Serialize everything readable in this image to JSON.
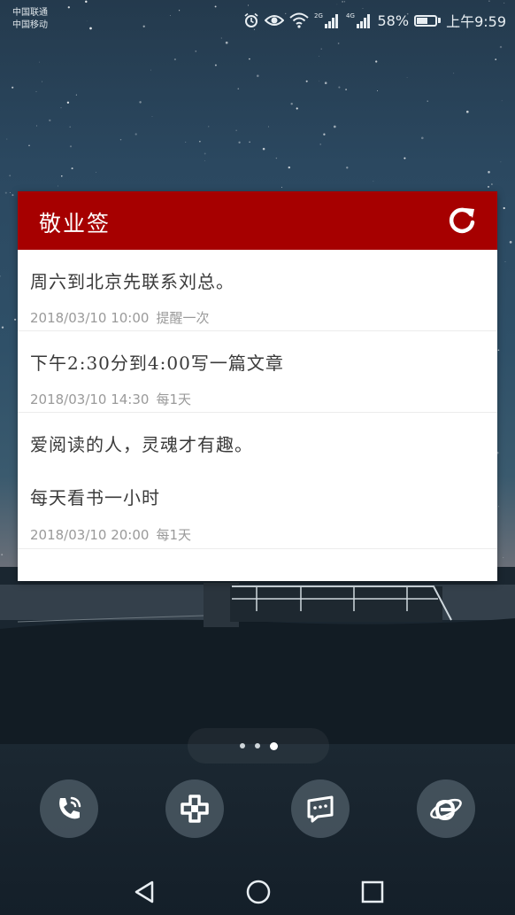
{
  "status_bar": {
    "carrier_1": "中国联通",
    "carrier_2": "中国移动",
    "sim1_network": "2G",
    "sim2_network": "4G",
    "battery_percent": "58%",
    "battery_level": 0.58,
    "time": "上午9:59",
    "icons": [
      "alarm-icon",
      "eye-icon",
      "wifi-icon",
      "signal-icon",
      "battery-icon"
    ]
  },
  "widget": {
    "title": "敬业签",
    "header_color": "#a60000",
    "refresh_icon": "refresh-icon",
    "notes": [
      {
        "lines": [
          "周六到北京先联系刘总。"
        ],
        "date": "2018/03/10  10:00",
        "reminder": "提醒一次"
      },
      {
        "lines": [
          "下午2:30分到4:00写一篇文章"
        ],
        "date": "2018/03/10  14:30",
        "reminder": "每1天"
      },
      {
        "lines": [
          "爱阅读的人，灵魂才有趣。",
          "每天看书一小时"
        ],
        "date": "2018/03/10  20:00",
        "reminder": "每1天"
      }
    ]
  },
  "home": {
    "page_count": 3,
    "active_page": 3,
    "dock": [
      {
        "name": "phone-app",
        "icon": "phone-icon"
      },
      {
        "name": "health-app",
        "icon": "health-cross-icon"
      },
      {
        "name": "messages-app",
        "icon": "message-icon"
      },
      {
        "name": "browser-app",
        "icon": "browser-e-icon"
      }
    ]
  },
  "nav_bar": {
    "buttons": [
      "back-icon",
      "home-icon",
      "recents-icon"
    ]
  }
}
